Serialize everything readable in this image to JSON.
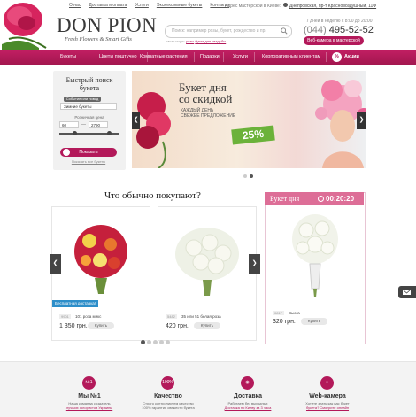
{
  "header": {
    "top_links": [
      "О нас",
      "Доставка и оплата",
      "Услуги",
      "Эксклюзивные букеты",
      "Контакты"
    ],
    "address_prefix": "Адрес мастерской в Киеве:",
    "address": "Днепровская, пр-т Красновоздушный, 11Ф",
    "hours": "7 дней в неделю с 8:00 до 20:00",
    "phone_code": "(044)",
    "phone_number": "495-52-52",
    "webcam_button": "Веб-камера в мастерской",
    "logo": "DON PION",
    "tagline": "Fresh Flowers & Smart Gifts",
    "search_placeholder": "Поиск: например розы, букет, рождество и пр.",
    "often_searched_label": "часто ищут:",
    "often_searched": [
      "розы",
      "букет для свадьбы"
    ]
  },
  "nav": {
    "items": [
      "Букеты",
      "Цветы поштучно",
      "Комнатные растения",
      "Подарки",
      "Услуги",
      "Корпоративным клиентам",
      "Акции"
    ],
    "action_badge": "%"
  },
  "filter": {
    "title": "Быстрый поиск букета",
    "event_pill": "Событие или повод",
    "event_value": "Зимние букеты",
    "price_label": "Розничная цена",
    "price_min": "60",
    "price_max": "2790",
    "range_min_frac": 0.25,
    "range_max_frac": 0.82,
    "dash": "—",
    "button": "Показать",
    "show_all": "Показать все букеты"
  },
  "banner": {
    "title_line1": "Букет дня",
    "title_line2": "со скидкой",
    "subtitle_line1": "КАЖДЫЙ ДЕНЬ",
    "subtitle_line2": "СВЕЖЕЕ ПРЕДЛОЖЕНИЕ",
    "sale": "25%",
    "slides": 2,
    "active_slide": 1
  },
  "popular": {
    "title": "Что обычно покупают?",
    "products": [
      {
        "article": "9901",
        "name": "101 роза микс",
        "price": "1 350 грн.",
        "buy": "Купить",
        "badge": "Бесплатная доставка!"
      },
      {
        "article": "5482",
        "name": "35 или 51 белая роза",
        "price": "420 грн.",
        "buy": "Купить"
      },
      {
        "article": "0817",
        "name": "Вьюга",
        "price": "320 грн.",
        "buy": "Купить"
      }
    ],
    "deal_of_day": "Букет дня",
    "timer": "00:20:20",
    "pages": 5,
    "active_page": 0
  },
  "features": [
    {
      "icon": "№1",
      "title": "Мы №1",
      "line1": "Наша команда создатель",
      "link": "лучших флористов Украины",
      "line2": ""
    },
    {
      "icon": "100%",
      "title": "Качество",
      "line1": "Строго контролируем качество",
      "link": "",
      "line2": "100% гарантия свежести букета"
    },
    {
      "icon": "car",
      "title": "Доставка",
      "line1": "Работаем без выходных",
      "link": "Доставка по Киеву за 3 часа",
      "line2": ""
    },
    {
      "icon": "cam",
      "title": "Web-камера",
      "line1": "Хотите знать как вас букет",
      "link": "",
      "line2": "букета? Смотрите онлайн"
    }
  ],
  "colors": {
    "brand": "#b3195a",
    "deal_header": "#dd6e97",
    "sale_badge": "#6bb23a",
    "free_badge": "#2d8ec9"
  }
}
